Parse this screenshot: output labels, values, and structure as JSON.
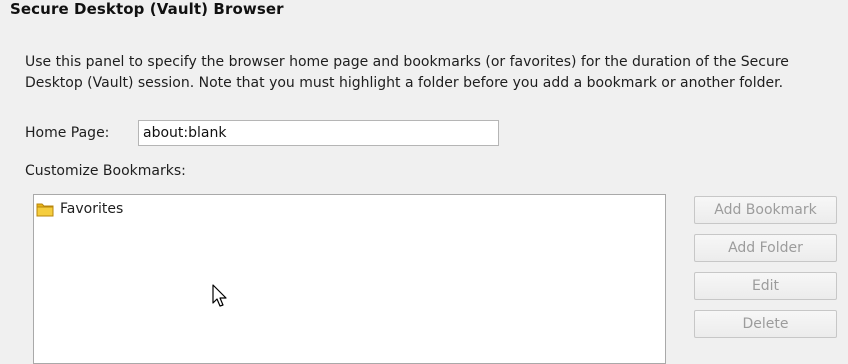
{
  "panel": {
    "title": "Secure Desktop (Vault) Browser",
    "description": "Use this panel to specify the browser home page and bookmarks (or favorites) for the duration of the Secure Desktop (Vault) session. Note that you must highlight a folder before you add a bookmark or another folder."
  },
  "home_page": {
    "label": "Home Page:",
    "value": "about:blank"
  },
  "bookmarks": {
    "label": "Customize Bookmarks:",
    "items": [
      {
        "label": "Favorites",
        "icon": "folder-icon",
        "icon_color": "#e8b417"
      }
    ]
  },
  "buttons": {
    "add_bookmark": "Add Bookmark",
    "add_folder": "Add Folder",
    "edit": "Edit",
    "delete": "Delete"
  },
  "colors": {
    "background": "#f0f0f0",
    "disabled_text": "#9c9c9c",
    "folder": "#e8b417"
  }
}
